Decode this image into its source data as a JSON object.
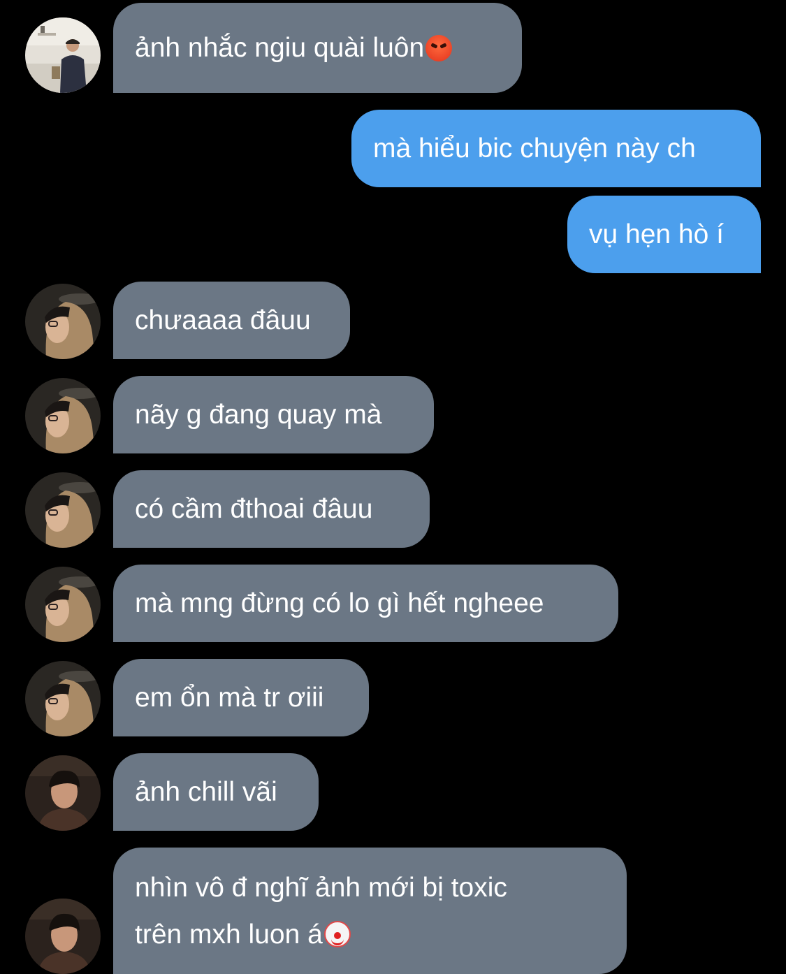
{
  "conversation": {
    "messages": [
      {
        "id": "m1",
        "direction": "incoming",
        "text": "ảnh nhắc ngiu quài luôn",
        "emoji": "angry-face"
      },
      {
        "id": "m2",
        "direction": "outgoing",
        "text": "mà hiểu bic chuyện này ch"
      },
      {
        "id": "m3",
        "direction": "outgoing",
        "text": "vụ hẹn hò í"
      },
      {
        "id": "m4",
        "direction": "incoming",
        "text": "chưaaaa đâuu"
      },
      {
        "id": "m5",
        "direction": "incoming",
        "text": "nãy g đang quay mà"
      },
      {
        "id": "m6",
        "direction": "incoming",
        "text": "có cầm đthoai đâuu"
      },
      {
        "id": "m7",
        "direction": "incoming",
        "text": "mà mng đừng có lo gì hết ngheee"
      },
      {
        "id": "m8",
        "direction": "incoming",
        "text": "em ổn mà tr ơiii"
      },
      {
        "id": "m9",
        "direction": "incoming",
        "text": "ảnh chill vãi"
      },
      {
        "id": "m10",
        "direction": "incoming",
        "line1": "nhìn vô đ nghĩ ảnh mới bị toxic",
        "line2": "trên mxh luon á",
        "emoji": "clown-face"
      }
    ]
  },
  "colors": {
    "background": "#000000",
    "incoming_bubble": "#6b7785",
    "outgoing_bubble": "#4c9fed",
    "text": "#ffffff"
  }
}
